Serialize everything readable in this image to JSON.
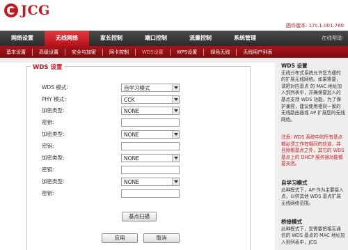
{
  "brand": {
    "logo_text": "JCG"
  },
  "firmware": "固件版本: 17s.1.001.760",
  "nav_main": {
    "items": [
      "网络设置",
      "无线网络",
      "家长控制",
      "端口控制",
      "流量控制",
      "系统管理"
    ],
    "active_index": 1,
    "right_link": "在线帮助"
  },
  "nav_sub": {
    "items": [
      "基本设置",
      "高级设置",
      "安全与加密",
      "网卡控制",
      "WDS设置",
      "WPS设置",
      "绿色无线",
      "无线用户列表"
    ],
    "active_index": 4
  },
  "panel": {
    "title": "WDS 设置",
    "wds_mode_label": "WDS 模式:",
    "wds_mode_value": "自学习模式",
    "phy_mode_label": "PHY 模式:",
    "phy_mode_value": "CCK",
    "encrypt_label": "加密类型:",
    "encrypt_value": "NONE",
    "key_label": "密钥:"
  },
  "buttons": {
    "scan": "基点扫描",
    "apply": "应用",
    "cancel": "取消"
  },
  "sidebar": {
    "title1": "WDS 设置",
    "text1": "无线分布式系统允许您方便的的扩展无线网络。如果需要，请把对应基点 的 MAC 地址加入到列表中，并确保要加入的基点支持 WDS 功能，为了保护兼容，建议使用相同一家的无线路由器或 AP 扩展您的无线网络。",
    "warning": "注意: WDS 系统中的所有基点都必须工作在相同的信道，并且除根基点之外，其它的 WDS 基点上的 DHCP 服务器功能都要关闭。",
    "title2": "自学习模式",
    "text2": "此种模式下，AP 作为主要接入点，以供其他 WDS 基点扩展无线网络范围。",
    "title3": "桥接模式",
    "text3": "此种模式下，您需要把相互通信的 WDS 基点的 MAC 地址加入到列表中，JCG"
  },
  "colors": {
    "brand_red": "#c8161d",
    "nav_dark": "#333333",
    "subnav_red": "#9b1015",
    "sidebar_bg": "#eeeeee"
  }
}
